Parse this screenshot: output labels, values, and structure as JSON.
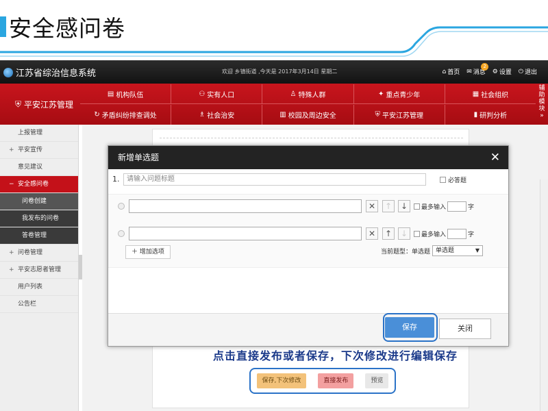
{
  "slide_title": "安全感问卷",
  "app": {
    "title": "江苏省综治信息系统",
    "welcome": "欢迎 乡镇街道 ,今天是 2017年3月14日 星期二",
    "top_links": {
      "home": "首页",
      "messages": "消息",
      "message_count": "2",
      "settings": "设置",
      "logout": "退出"
    }
  },
  "nav": {
    "brand": "平安江苏管理",
    "row1": [
      "机构队伍",
      "实有人口",
      "特殊人群",
      "重点青少年",
      "社会组织"
    ],
    "row2": [
      "矛盾纠纷排查调处",
      "社会治安",
      "校园及周边安全",
      "平安江苏管理",
      "研判分析"
    ],
    "helper": "辅助模块"
  },
  "sidebar": {
    "items": [
      {
        "label": "上报管理",
        "prefix": ""
      },
      {
        "label": "平安宣传",
        "prefix": "+"
      },
      {
        "label": "意见建议",
        "prefix": ""
      },
      {
        "label": "安全感问卷",
        "prefix": "−"
      },
      {
        "label": "问卷创建",
        "prefix": ""
      },
      {
        "label": "我发布的问卷",
        "prefix": ""
      },
      {
        "label": "答卷管理",
        "prefix": ""
      },
      {
        "label": "问卷管理",
        "prefix": "+"
      },
      {
        "label": "平安志愿者管理",
        "prefix": "+"
      },
      {
        "label": "用户列表",
        "prefix": ""
      },
      {
        "label": "公告栏",
        "prefix": ""
      }
    ]
  },
  "content": {
    "behind_text": "点击直接发布或者保存，下次修改进行编辑保存",
    "actions": {
      "save_draft": "保存,下次修改",
      "publish": "直接发布",
      "preview": "预览"
    }
  },
  "modal": {
    "title": "新增单选题",
    "close_glyph": "✕",
    "question_number": "1.",
    "question_placeholder": "请输入问题标题",
    "required_label": "必答题",
    "options": [
      {
        "value": "",
        "up_enabled": false,
        "down_enabled": true,
        "max_label": "最多输入",
        "unit": "字"
      },
      {
        "value": "",
        "up_enabled": true,
        "down_enabled": false,
        "max_label": "最多输入",
        "unit": "字"
      }
    ],
    "add_option": "增加选项",
    "qtype_label": "当前题型：单选题",
    "qtype_value": "单选题",
    "save": "保存",
    "close": "关闭"
  },
  "colors": {
    "accent_blue": "#2aa6e0",
    "nav_red": "#c41119",
    "highlight_blue": "#2a72c7"
  }
}
